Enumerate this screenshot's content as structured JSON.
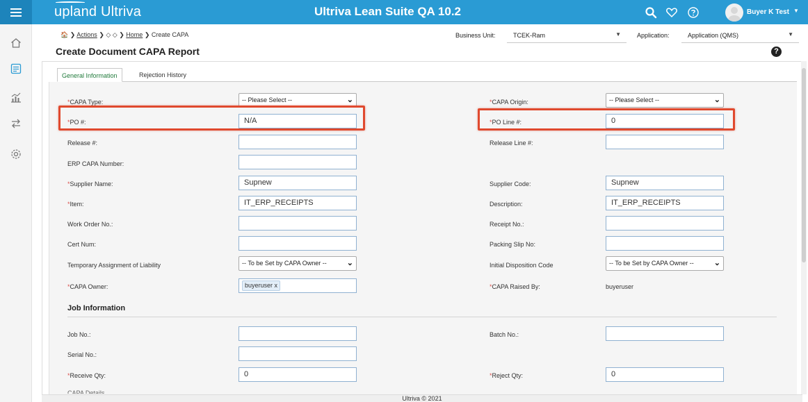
{
  "topbar": {
    "brand": "upland Ultriva",
    "app_title": "Ultriva Lean Suite QA 10.2",
    "user_name": "Buyer K Test",
    "icons": [
      "search-icon",
      "heart-icon",
      "help-circle-icon"
    ]
  },
  "sidebar": {
    "icons": [
      "home-icon",
      "checklist-icon",
      "chart-icon",
      "transfer-icon",
      "settings-icon"
    ]
  },
  "breadcrumb": {
    "home_glyph": "🏠",
    "actions": "Actions",
    "home": "Home",
    "current": "Create CAPA"
  },
  "page_title": "Create Document CAPA Report",
  "help_label": "?",
  "business_unit": {
    "label": "Business Unit:",
    "value": "TCEK-Ram"
  },
  "application": {
    "label": "Application:",
    "value": "Application (QMS)"
  },
  "tabs": {
    "general": "General Information",
    "rejection": "Rejection History"
  },
  "form": {
    "capa_type": {
      "label": "CAPA Type:",
      "value": "-- Please Select --"
    },
    "capa_origin": {
      "label": "CAPA Origin:",
      "value": "-- Please Select --"
    },
    "po": {
      "label": "PO #:",
      "value": "N/A"
    },
    "po_line": {
      "label": "PO Line #:",
      "value": "0"
    },
    "release": {
      "label": "Release #:",
      "value": ""
    },
    "release_line": {
      "label": "Release Line #:",
      "value": ""
    },
    "erp_capa": {
      "label": "ERP CAPA Number:",
      "value": ""
    },
    "supplier_name": {
      "label": "Supplier Name:",
      "value": "Supnew"
    },
    "supplier_code": {
      "label": "Supplier Code:",
      "value": "Supnew"
    },
    "item": {
      "label": "Item:",
      "value": "IT_ERP_RECEIPTS"
    },
    "description": {
      "label": "Description:",
      "value": "IT_ERP_RECEIPTS"
    },
    "work_order": {
      "label": "Work Order No.:",
      "value": ""
    },
    "receipt_no": {
      "label": "Receipt No.:",
      "value": ""
    },
    "cert_num": {
      "label": "Cert Num:",
      "value": ""
    },
    "packing_slip": {
      "label": "Packing Slip No:",
      "value": ""
    },
    "temp_assignment": {
      "label": "Temporary Assignment of Liability",
      "value": "-- To be Set by CAPA Owner --"
    },
    "initial_disposition": {
      "label": "Initial Disposition Code",
      "value": "-- To be Set by CAPA Owner --"
    },
    "capa_owner": {
      "label": "CAPA Owner:",
      "tag": "buyeruser",
      "tag_remove": "x"
    },
    "capa_raised_by": {
      "label": "CAPA Raised By:",
      "value": "buyeruser"
    }
  },
  "job_section": {
    "title": "Job Information",
    "job_no": {
      "label": "Job No.:",
      "value": ""
    },
    "batch_no": {
      "label": "Batch No.:",
      "value": ""
    },
    "serial_no": {
      "label": "Serial No.:",
      "value": ""
    },
    "receive_qty": {
      "label": "Receive Qty:",
      "value": "0"
    },
    "reject_qty": {
      "label": "Reject Qty:",
      "value": "0"
    }
  },
  "required_mark": "*",
  "next_section_cut": "CAPA Details",
  "footer": "Ultriva © 2021",
  "colors": {
    "topbar": "#2a9bd4",
    "highlight": "#e0492e",
    "active_tab": "#1f7a3a",
    "required": "#d9534f"
  }
}
